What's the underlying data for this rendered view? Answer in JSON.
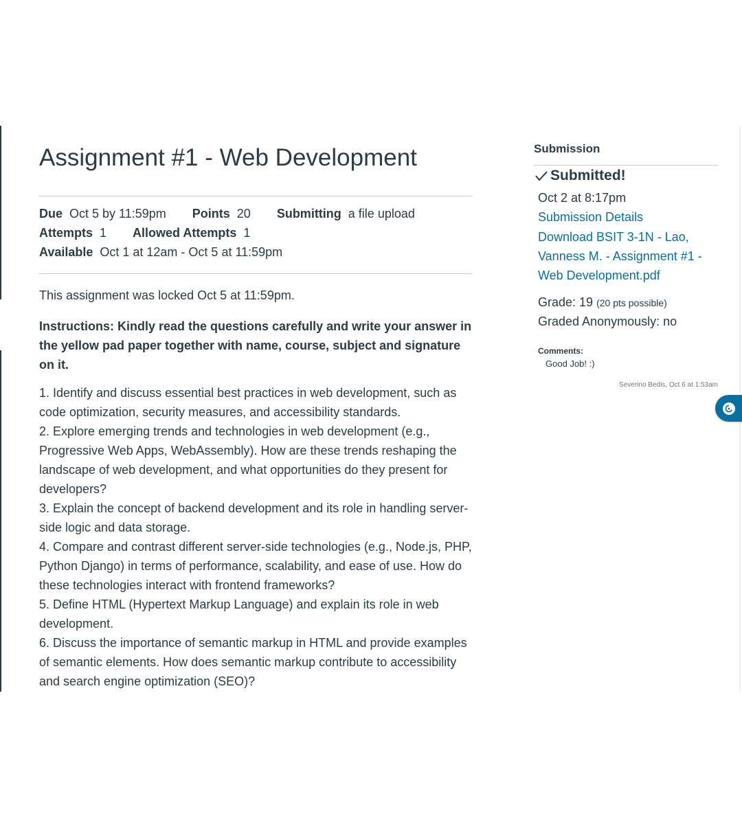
{
  "assignment": {
    "title": "Assignment #1 - Web Development",
    "details": {
      "due_label": "Due",
      "due_value": "Oct 5 by 11:59pm",
      "points_label": "Points",
      "points_value": "20",
      "submitting_label": "Submitting",
      "submitting_value": "a file upload",
      "attempts_label": "Attempts",
      "attempts_value": "1",
      "allowed_attempts_label": "Allowed Attempts",
      "allowed_attempts_value": "1",
      "available_label": "Available",
      "available_value": "Oct 1 at 12am - Oct 5 at 11:59pm"
    },
    "lock_note": "This assignment was locked Oct 5 at 11:59pm.",
    "instructions": "Instructions: Kindly read the questions carefully and write your answer in the yellow pad paper together with name, course, subject and signature on it.",
    "questions": [
      "1. Identify and discuss essential best practices in web development, such as code optimization, security measures, and accessibility standards.",
      "2. Explore emerging trends and technologies in web development (e.g., Progressive Web Apps, WebAssembly). How are these trends reshaping the landscape of web development, and what opportunities do they present for developers?",
      "3. Explain the concept of backend development and its role in handling server-side logic and data storage.",
      "4. Compare and contrast different server-side technologies (e.g., Node.js, PHP, Python Django) in terms of performance, scalability, and ease of use. How do these technologies interact with frontend frameworks?",
      "5. Define HTML (Hypertext Markup Language) and explain its role in web development.",
      "6. Discuss the importance of semantic markup in HTML and provide examples of semantic elements. How does semantic markup contribute to accessibility and search engine optimization (SEO)?"
    ]
  },
  "submission": {
    "heading": "Submission",
    "status": "Submitted!",
    "submitted_at": "Oct 2 at 8:17pm",
    "details_link": "Submission Details",
    "download_link": "Download BSIT 3-1N - Lao, Vanness M. - Assignment #1 - Web Development.pdf",
    "grade_label": "Grade: 19",
    "grade_possible": "(20 pts possible)",
    "graded_anonymously": "Graded Anonymously: no",
    "comments_label": "Comments:",
    "comment_text": "Good Job! :)",
    "comment_author": "Severino Bedis, Oct 6 at 1:53am"
  },
  "icons": {
    "check": "check-icon",
    "floating": "chat-bubble-icon"
  },
  "colors": {
    "text": "#2d3b45",
    "link": "#0770a3",
    "rule": "#c7cdd1"
  }
}
